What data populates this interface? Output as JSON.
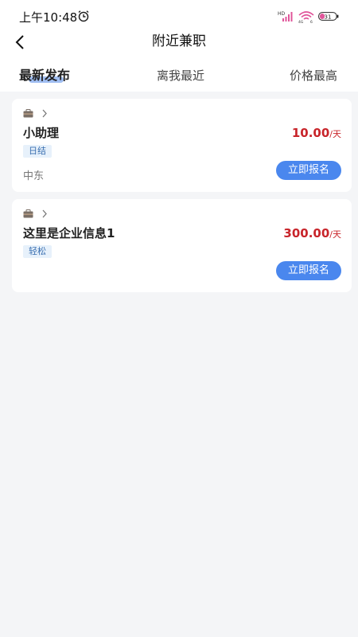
{
  "status_bar": {
    "time": "上午10:48",
    "battery_level": "31"
  },
  "nav": {
    "title": "附近兼职"
  },
  "tabs": [
    {
      "label": "最新发布",
      "active": true
    },
    {
      "label": "离我最近",
      "active": false
    },
    {
      "label": "价格最高",
      "active": false
    }
  ],
  "jobs": [
    {
      "title": "小助理",
      "salary": "10.00",
      "unit": "/天",
      "tag": "日结",
      "location": "中东",
      "apply_label": "立即报名"
    },
    {
      "title": "这里是企业信息1",
      "salary": "300.00",
      "unit": "/天",
      "tag": "轻松",
      "location": "",
      "apply_label": "立即报名"
    }
  ],
  "colors": {
    "accent": "#4a87ee",
    "price": "#c8242a",
    "tag_bg": "#e7f1fb",
    "background": "#f4f5f7"
  },
  "icons": {
    "back": "back-icon",
    "alarm": "alarm-icon",
    "signal": "signal-icon",
    "wifi": "wifi-icon",
    "battery": "battery-icon",
    "company": "briefcase-icon",
    "chevron": "chevron-right-icon"
  }
}
